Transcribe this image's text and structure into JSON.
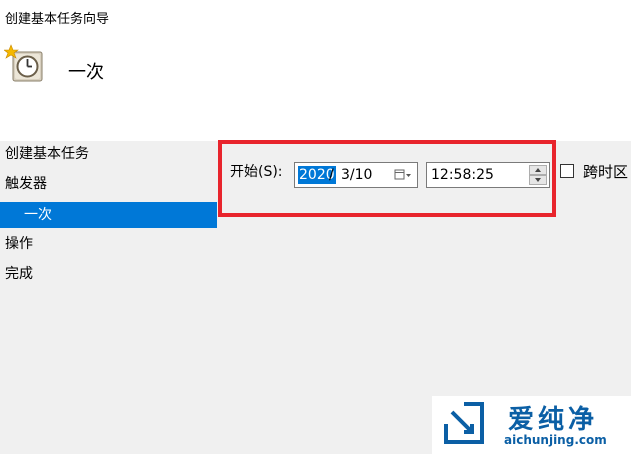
{
  "window": {
    "wizard_title": "创建基本任务向导",
    "page_title": "一次",
    "icon": "task-scheduler-clock-icon"
  },
  "sidebar": {
    "items": [
      {
        "label": "创建基本任务",
        "selected": false
      },
      {
        "label": "触发器",
        "selected": false
      },
      {
        "label": "一次",
        "selected": true
      },
      {
        "label": "操作",
        "selected": false
      },
      {
        "label": "完成",
        "selected": false
      }
    ]
  },
  "trigger": {
    "start_label": "开始(S):",
    "date": {
      "year": "2020",
      "separator": "/",
      "month_day": "3/10"
    },
    "time": "12:58:25",
    "timezone_checkbox": {
      "label": "跨时区",
      "checked": false
    }
  },
  "highlight_color": "#e8242c",
  "selection_color": "#0078d7",
  "watermark": {
    "brand": "爱纯净",
    "url": "aichunjing.com",
    "color": "#0b5fa5"
  }
}
